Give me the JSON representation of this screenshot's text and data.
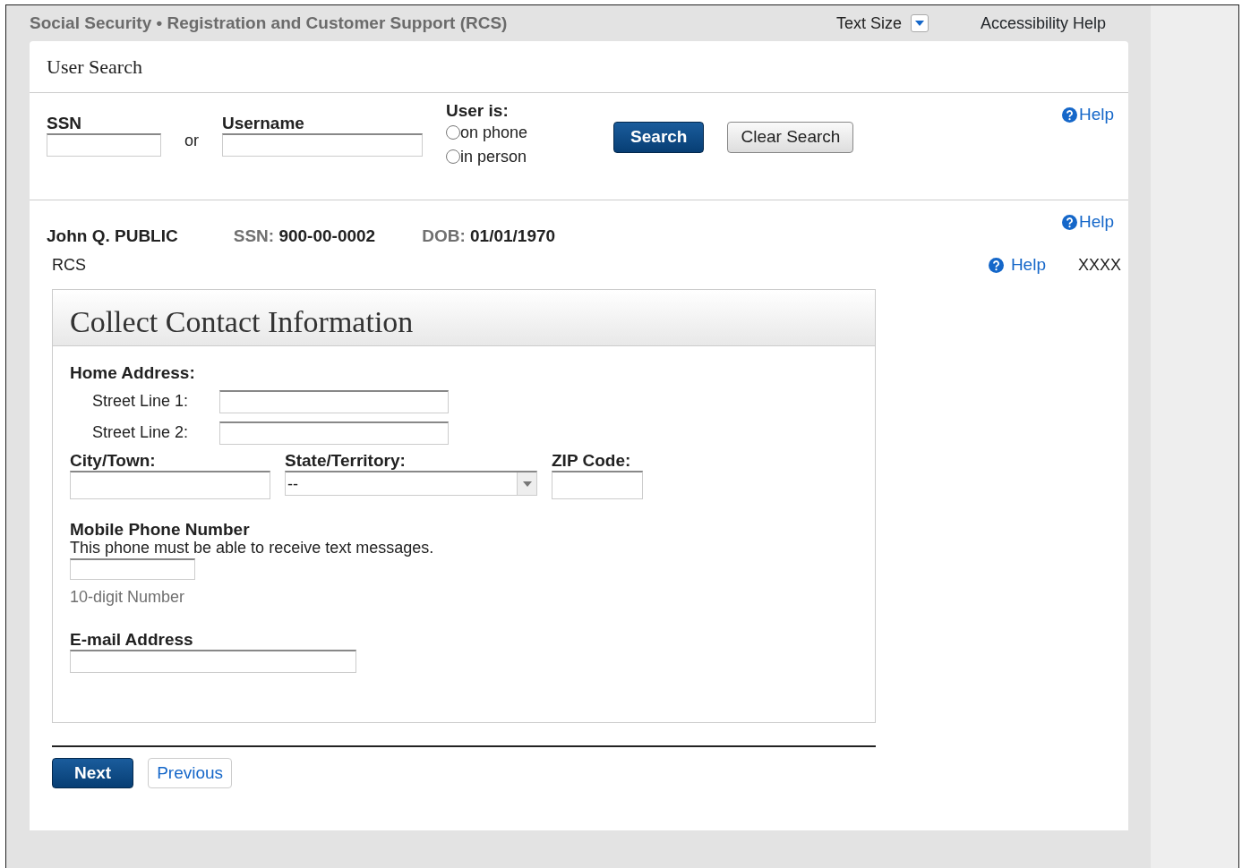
{
  "header": {
    "title": "Social Security • Registration and Customer Support (RCS)",
    "text_size": "Text Size",
    "accessibility_help": "Accessibility Help"
  },
  "user_search": {
    "title": "User Search",
    "ssn_label": "SSN",
    "or_label": "or",
    "username_label": "Username",
    "user_is_label": "User is:",
    "radios": [
      {
        "label": "on phone",
        "selected": false
      },
      {
        "label": "in person",
        "selected": false
      }
    ],
    "search_button": "Search",
    "clear_button": "Clear Search",
    "help": "Help"
  },
  "person": {
    "name": "John Q. PUBLIC",
    "ssn_label": "SSN:",
    "ssn": "900-00-0002",
    "dob_label": "DOB:",
    "dob": "01/01/1970",
    "help": "Help"
  },
  "program": {
    "label": "RCS",
    "help": "Help",
    "code": "XXXX"
  },
  "form": {
    "title": "Collect Contact Information",
    "home_address_label": "Home Address:",
    "street_lines": [
      {
        "label": "Street Line 1:"
      },
      {
        "label": "Street Line 2:"
      }
    ],
    "city_label": "City/Town:",
    "state_label": "State/Territory:",
    "state_value": "--",
    "zip_label": "ZIP Code:",
    "mobile_label": "Mobile Phone Number",
    "mobile_note": "This phone must be able to receive text messages.",
    "mobile_hint": "10-digit Number",
    "email_label": "E-mail Address"
  },
  "buttons": {
    "next": "Next",
    "previous": "Previous"
  }
}
